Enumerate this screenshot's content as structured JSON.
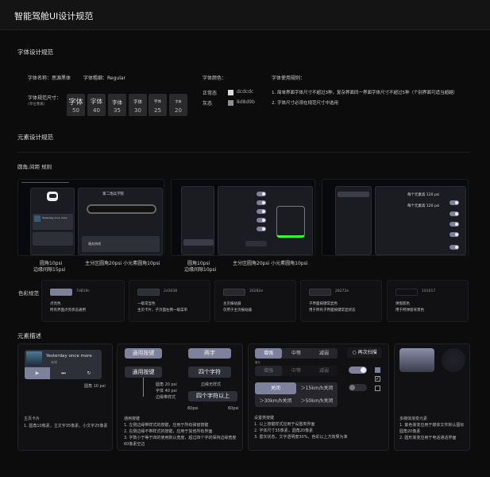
{
  "title": "智能驾舱UI设计规范",
  "font_section": {
    "heading": "字体设计规范",
    "font_name": "字体名称：思源黑体",
    "font_weight": "字体粗细：Regular",
    "size_label": "字体规范尺寸：",
    "size_unit": "(单位像素)",
    "sample": "字体",
    "sizes": [
      "50",
      "40",
      "35",
      "30",
      "25",
      "20"
    ],
    "color_label": "字体颜色：",
    "colors": [
      {
        "state": "正常态",
        "hex": "dcdcdc",
        "color": "#dcdcdc"
      },
      {
        "state": "灰态",
        "hex": "8d8d9b",
        "color": "#8d8d9b"
      }
    ],
    "rules_label": "字体使用规则：",
    "rules": [
      "1. 简单界面字体尺寸不超过3种，复杂界面同一界面字体尺寸不超过5种（个别界面可适当超越）",
      "2. 字体尺寸必须在规范尺寸中选用"
    ]
  },
  "element_section": {
    "heading": "元素设计规范",
    "radius_heading": "圆角,间距 规则",
    "screen1": {
      "route_title": "第二炮兵学院",
      "song": "Yesterday once more",
      "hotline": "服务热线",
      "caption_left_1": "圆角10psi",
      "caption_left_2": "边缘间隙15psi",
      "caption_right": "主分区圆角20psi   小元素圆角10psi"
    },
    "screen2": {
      "caption_left_1": "圆角10psi",
      "caption_left_2": "边缘间隙10psi",
      "caption_right": "主分区圆角20psi   小元素圆角10psi"
    },
    "screen3": {
      "height_note_1": "每个元素高 120 psi",
      "height_note_2": "每个元素高 120 psi"
    }
  },
  "color_section": {
    "heading": "色彩规范",
    "items": [
      {
        "hex": "7d819c",
        "color": "#7d819c",
        "name": "点亮色",
        "desc": "所有界面点亮状态通用"
      },
      {
        "hex": "2d3038",
        "color": "#2d3038",
        "name": "一级常显色",
        "desc": "主页卡片，子页面左侧一级菜单"
      },
      {
        "hex": "26282e",
        "color": "#26282e",
        "name": "主页报站器",
        "desc": "仅用于主页报站器"
      },
      {
        "hex": "28272e",
        "color": "#28272e",
        "name": "子界面按键常显色",
        "desc": "用于所有子界面按键常显状态"
      },
      {
        "hex": "101017",
        "color": "#101017",
        "name": "弹窗底色",
        "desc": "用于所弹窗背景色"
      }
    ]
  },
  "desc_section": {
    "heading": "元素描述",
    "card_home": {
      "song": "Yesterday once more",
      "artist": "未知",
      "radius_note": "圆角 10 psi",
      "title": "主页卡片",
      "lines": [
        "1. 圆角10像素，主文字35像素，小文字25像素"
      ]
    },
    "card_buttons": {
      "btn_general": "通用按键",
      "btn_two": "两字",
      "btn_general2": "通用按键",
      "btn_four": "四个字符",
      "btn_more": "四个字符以上",
      "ann_radius": "圆角 20 psi",
      "ann_font": "字体 40 psi",
      "ann_edge": "边缘带样式",
      "ann_noedge": "边缘无样式",
      "pad_left": "60psi",
      "pad_right": "60psi",
      "title": "通用按键",
      "lines": [
        "1. 左侧边缘带样式的按键，应用于所有弹窗按键",
        "2. 右侧边缘不带样式的按键，应用于其他所有界面",
        "3. 字数小于等于四的使用默认宽度，超过四个字的保持边缘宽度",
        "   60像素空边"
      ]
    },
    "card_settings": {
      "seg": [
        "增强",
        "中等",
        "减弱"
      ],
      "disabled_note": "置灰",
      "grid": [
        "关闭",
        "＞15km/h关闭",
        "＞30km/h关闭",
        "＞50km/h关闭"
      ],
      "scan": "再次扫描",
      "toggle_on": true,
      "toggle_off": false,
      "title": "设置类按键",
      "lines": [
        "1. 以上按键样式应用于设置类界面",
        "2. 字体尺寸35像素，圆角20像素",
        "3. 置灰状态，文字透明度30%，色彩以上方效果为准"
      ]
    },
    "card_media": {
      "title": "多媒体渐变元素",
      "lines": [
        "1. 紫色渐变应用于媒体文件默认图标",
        "   圆角20像素",
        "2. 圆形渐变应用于电话通话界面"
      ]
    }
  }
}
